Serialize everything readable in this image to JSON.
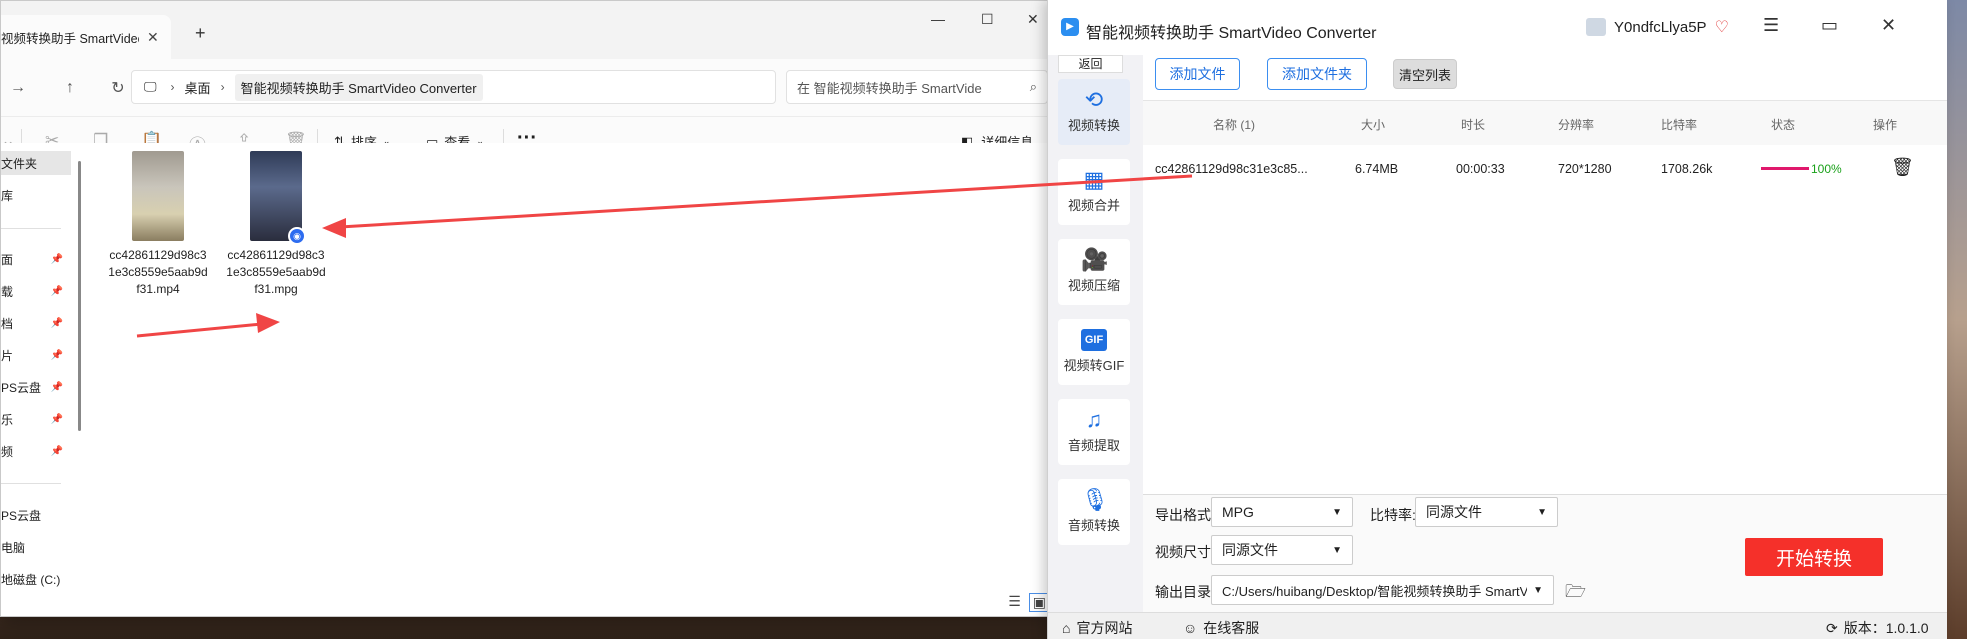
{
  "explorer": {
    "tab_title": "视频转换助手 SmartVideo",
    "tab_close": "✕",
    "new_tab": "+",
    "window_controls": {
      "minimize": "—",
      "maximize": "☐",
      "close": "✕"
    },
    "address": {
      "crumbs": [
        "桌面",
        "智能视频转换助手 SmartVideo Converter"
      ]
    },
    "search_placeholder": "在 智能视频转换助手 SmartVide",
    "toolbar": {
      "sort": "排序",
      "view": "查看",
      "more": "···",
      "details": "详细信息"
    },
    "sidebar": [
      {
        "label": "文件夹",
        "pinned": false,
        "selected": true
      },
      {
        "label": "库",
        "pinned": false
      },
      {
        "label": "面",
        "pinned": true
      },
      {
        "label": "载",
        "pinned": true
      },
      {
        "label": "档",
        "pinned": true
      },
      {
        "label": "片",
        "pinned": true
      },
      {
        "label": "PS云盘",
        "pinned": true
      },
      {
        "label": "乐",
        "pinned": true
      },
      {
        "label": "频",
        "pinned": true
      },
      {
        "label": "PS云盘",
        "pinned": false
      },
      {
        "label": "电脑",
        "pinned": false
      },
      {
        "label": "地磁盘 (C:)",
        "pinned": false
      }
    ],
    "files": [
      {
        "name": "cc42861129d98c31e3c8559e5aab9df31.mp4"
      },
      {
        "name": "cc42861129d98c31e3c8559e5aab9df31.mpg"
      }
    ]
  },
  "app": {
    "title": "智能视频转换助手 SmartVideo Converter",
    "username": "Y0ndfcLlya5P",
    "controls": {
      "menu": "☰",
      "restore": "▭",
      "close": "✕"
    },
    "back": "返回",
    "nav": [
      {
        "label": "视频转换",
        "icon": "video-convert-icon",
        "glyph": "⟲",
        "active": true
      },
      {
        "label": "视频合并",
        "icon": "video-merge-icon",
        "glyph": "▦"
      },
      {
        "label": "视频压缩",
        "icon": "video-compress-icon",
        "glyph": "🎥"
      },
      {
        "label": "视频转GIF",
        "icon": "gif-icon",
        "glyph": "GIF"
      },
      {
        "label": "音频提取",
        "icon": "music-note-icon",
        "glyph": "♫"
      },
      {
        "label": "音频转换",
        "icon": "microphone-icon",
        "glyph": "🎙"
      }
    ],
    "actions": {
      "add_file": "添加文件",
      "add_folder": "添加文件夹",
      "clear_list": "清空列表"
    },
    "table": {
      "columns": [
        "名称 (1)",
        "大小",
        "时长",
        "分辨率",
        "比特率",
        "状态",
        "操作"
      ],
      "rows": [
        {
          "name": "cc42861129d98c31e3c85...",
          "size": "6.74MB",
          "duration": "00:00:33",
          "resolution": "720*1280",
          "bitrate": "1708.26k",
          "progress": 1.0,
          "progress_text": "100%"
        }
      ]
    },
    "settings": {
      "format_label": "导出格式:",
      "format_value": "MPG",
      "bitrate_label": "比特率:",
      "bitrate_value": "同源文件",
      "size_label": "视频尺寸:",
      "size_value": "同源文件",
      "output_label": "输出目录:",
      "output_value": "C:/Users/huibang/Desktop/智能视频转换助手 SmartVideo",
      "start": "开始转换"
    },
    "footer": {
      "website": "官方网站",
      "support": "在线客服",
      "version": "版本：1.0.1.0"
    },
    "colors": {
      "accent": "#1e6fe0",
      "start": "#f5302a",
      "progress": "#e0186c",
      "status": "#1aa11a"
    }
  }
}
